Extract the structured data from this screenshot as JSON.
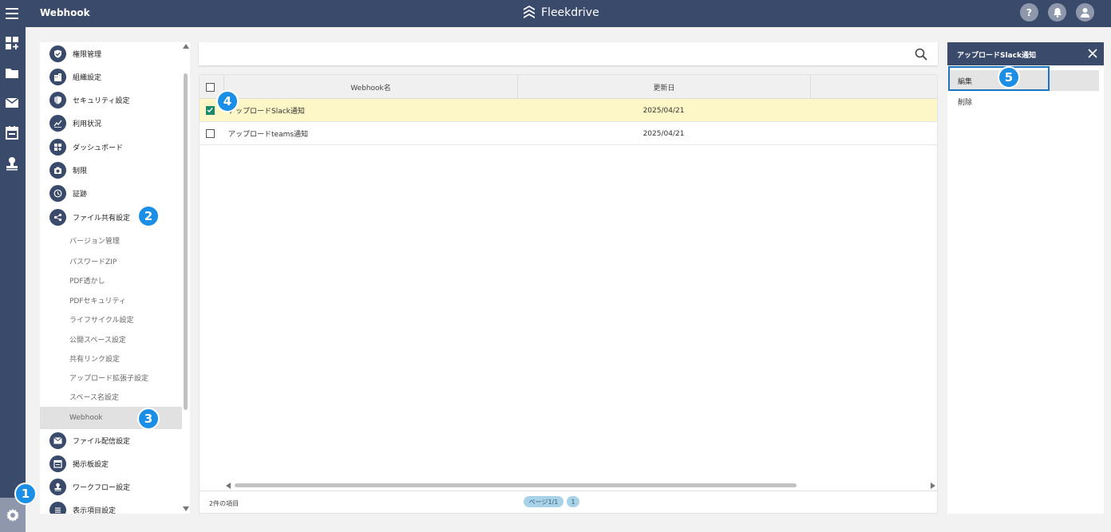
{
  "header": {
    "title": "Webhook",
    "brand": "Fleekdrive"
  },
  "rail": {
    "icons": [
      "dashboard-add-icon",
      "folder-icon",
      "mail-icon",
      "calendar-icon",
      "stamp-icon",
      "gear-icon"
    ]
  },
  "nav": {
    "items": [
      {
        "label": "権限管理",
        "icon": "shield-check-icon"
      },
      {
        "label": "組織設定",
        "icon": "building-icon"
      },
      {
        "label": "セキュリティ設定",
        "icon": "shield-lock-icon"
      },
      {
        "label": "利用状況",
        "icon": "chart-icon"
      },
      {
        "label": "ダッシュボード",
        "icon": "dashboard-icon"
      },
      {
        "label": "制限",
        "icon": "camera-icon"
      },
      {
        "label": "証跡",
        "icon": "clock-icon"
      },
      {
        "label": "ファイル共有設定",
        "icon": "share-icon"
      }
    ],
    "subitems": [
      "バージョン管理",
      "パスワードZIP",
      "PDF透かし",
      "PDFセキュリティ",
      "ライフサイクル設定",
      "公開スペース設定",
      "共有リンク設定",
      "アップロード拡張子設定",
      "スペース名設定",
      "Webhook"
    ],
    "active_sub": "Webhook",
    "items_after": [
      {
        "label": "ファイル配信設定",
        "icon": "mail-icon"
      },
      {
        "label": "掲示板設定",
        "icon": "board-icon"
      },
      {
        "label": "ワークフロー設定",
        "icon": "stamp-icon"
      },
      {
        "label": "表示項目設定",
        "icon": "list-icon"
      }
    ]
  },
  "search": {
    "placeholder": ""
  },
  "table": {
    "columns": [
      "Webhook名",
      "更新日"
    ],
    "rows": [
      {
        "name": "アップロードSlack通知",
        "date": "2025/04/21",
        "checked": true
      },
      {
        "name": "アップロードteams通知",
        "date": "2025/04/21",
        "checked": false
      }
    ],
    "count": "2件の項目",
    "page_label": "ページ1/1",
    "page_number": "1"
  },
  "detail": {
    "title": "アップロードSlack通知",
    "actions": [
      "編集",
      "削除"
    ]
  },
  "badges": [
    "1",
    "2",
    "3",
    "4",
    "5"
  ],
  "colors": {
    "primary": "#3a4a6b",
    "badge": "#1b8fe6",
    "selected_row": "#fdf6c6",
    "check": "#1b8a6b"
  }
}
